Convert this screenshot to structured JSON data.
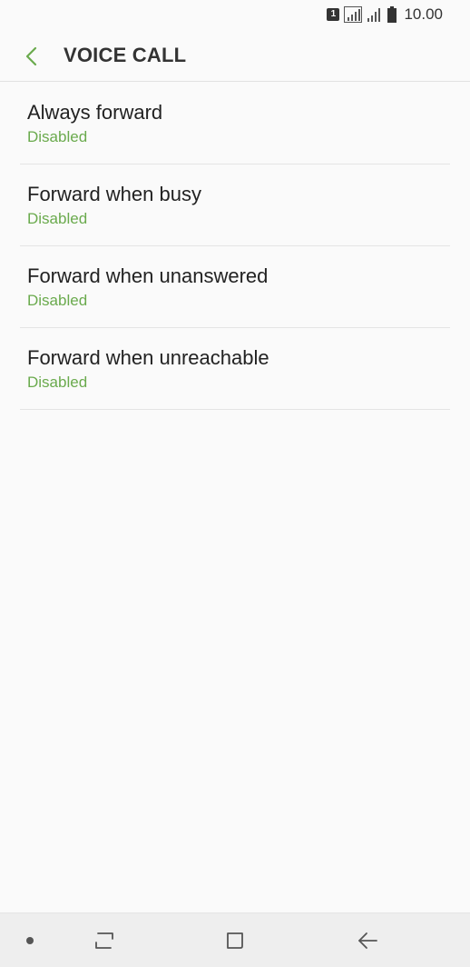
{
  "status_bar": {
    "sim_slot": "1",
    "time": "10.00",
    "icons": [
      "sim-card-icon",
      "signal-icon",
      "signal-icon",
      "battery-icon"
    ]
  },
  "header": {
    "title": "VOICE CALL",
    "back_icon": "chevron-left-icon"
  },
  "forwarding_options": [
    {
      "title": "Always forward",
      "status": "Disabled"
    },
    {
      "title": "Forward when busy",
      "status": "Disabled"
    },
    {
      "title": "Forward when unanswered",
      "status": "Disabled"
    },
    {
      "title": "Forward when unreachable",
      "status": "Disabled"
    }
  ],
  "nav_bar": {
    "icons": [
      "dot-icon",
      "recent-apps-icon",
      "home-icon",
      "back-arrow-icon"
    ]
  },
  "colors": {
    "accent": "#6aaa4d",
    "background": "#fafafa",
    "nav_background": "#eeeeee"
  }
}
